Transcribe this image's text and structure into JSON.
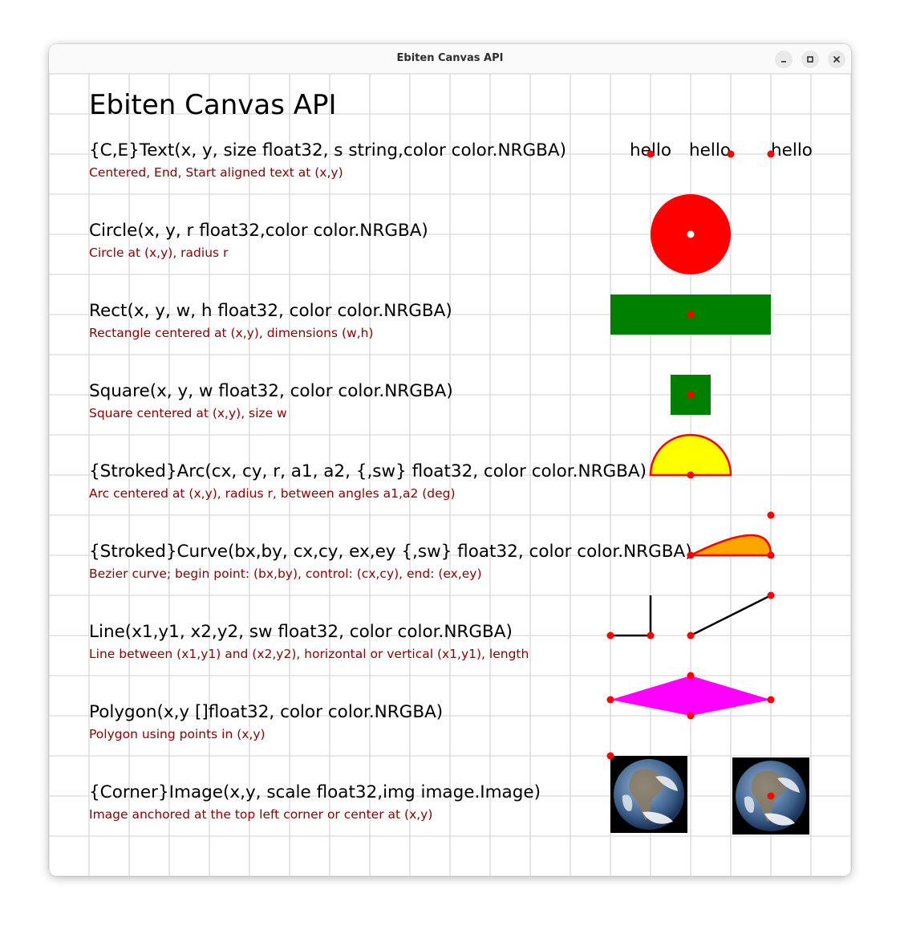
{
  "window": {
    "title": "Ebiten Canvas API"
  },
  "canvas": {
    "heading": "Ebiten Canvas API",
    "rows": [
      {
        "signature": "{C,E}Text(x, y, size float32, s string,color color.NRGBA)",
        "description": "Centered, End, Start aligned text at (x,y)"
      },
      {
        "signature": "Circle(x, y, r float32,color color.NRGBA)",
        "description": "Circle at (x,y), radius r"
      },
      {
        "signature": "Rect(x, y, w, h float32, color color.NRGBA)",
        "description": "Rectangle centered at (x,y), dimensions (w,h)"
      },
      {
        "signature": "Square(x, y, w float32, color color.NRGBA)",
        "description": "Square centered at (x,y), size w"
      },
      {
        "signature": "{Stroked}Arc(cx, cy, r, a1, a2, {,sw} float32, color color.NRGBA)",
        "description": "Arc centered at (x,y), radius r, between angles a1,a2 (deg)"
      },
      {
        "signature": "{Stroked}Curve(bx,by, cx,cy, ex,ey {,sw} float32, color color.NRGBA)",
        "description": "Bezier curve; begin point: (bx,by), control: (cx,cy), end: (ex,ey)"
      },
      {
        "signature": "Line(x1,y1, x2,y2, sw float32, color color.NRGBA)",
        "description": "Line between (x1,y1) and (x2,y2), horizontal or vertical (x1,y1), length"
      },
      {
        "signature": "Polygon(x,y []float32, color color.NRGBA)",
        "description": "Polygon using points in (x,y)"
      },
      {
        "signature": "{Corner}Image(x,y, scale float32,img image.Image)",
        "description": "Image anchored at the top left corner or center at (x,y)"
      }
    ],
    "text_samples": [
      "hello",
      "hello",
      "hello"
    ],
    "colors": {
      "grid": "#d9d9d9",
      "description": "#8b0000",
      "marker": "#ff0000",
      "circle": "#ff0000",
      "rect": "#008000",
      "arc_fill": "#ffff00",
      "curve_fill": "#ffa500",
      "polygon": "#ff00ff",
      "line": "#000000"
    }
  }
}
